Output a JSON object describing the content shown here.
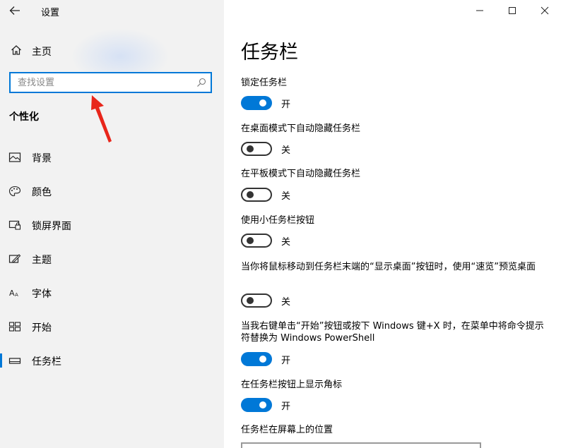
{
  "app": {
    "title": "设置"
  },
  "sidebar": {
    "home_label": "主页",
    "search_placeholder": "查找设置",
    "section_title": "个性化",
    "items": [
      {
        "label": "背景",
        "icon": "picture-icon"
      },
      {
        "label": "颜色",
        "icon": "palette-icon"
      },
      {
        "label": "锁屏界面",
        "icon": "lock-screen-icon"
      },
      {
        "label": "主题",
        "icon": "theme-icon"
      },
      {
        "label": "字体",
        "icon": "font-icon"
      },
      {
        "label": "开始",
        "icon": "start-icon"
      },
      {
        "label": "任务栏",
        "icon": "taskbar-icon",
        "selected": true
      }
    ]
  },
  "main": {
    "title": "任务栏",
    "settings": [
      {
        "label": "锁定任务栏",
        "state": "on",
        "state_text": "开"
      },
      {
        "label": "在桌面模式下自动隐藏任务栏",
        "state": "off",
        "state_text": "关"
      },
      {
        "label": "在平板模式下自动隐藏任务栏",
        "state": "off",
        "state_text": "关"
      },
      {
        "label": "使用小任务栏按钮",
        "state": "off",
        "state_text": "关"
      },
      {
        "label": "当你将鼠标移动到任务栏末端的“显示桌面”按钮时，使用“速览”预览桌面",
        "state": "off",
        "state_text": "关"
      },
      {
        "label": "当我右键单击“开始”按钮或按下 Windows 键+X 时，在菜单中将命令提示符替换为 Windows PowerShell",
        "state": "on",
        "state_text": "开"
      },
      {
        "label": "在任务栏按钮上显示角标",
        "state": "on",
        "state_text": "开"
      }
    ],
    "position_label": "任务栏在屏幕上的位置"
  },
  "colors": {
    "accent": "#0078d7",
    "sidebar_bg": "#f2f2f2",
    "annotation_arrow": "#e8261b"
  }
}
